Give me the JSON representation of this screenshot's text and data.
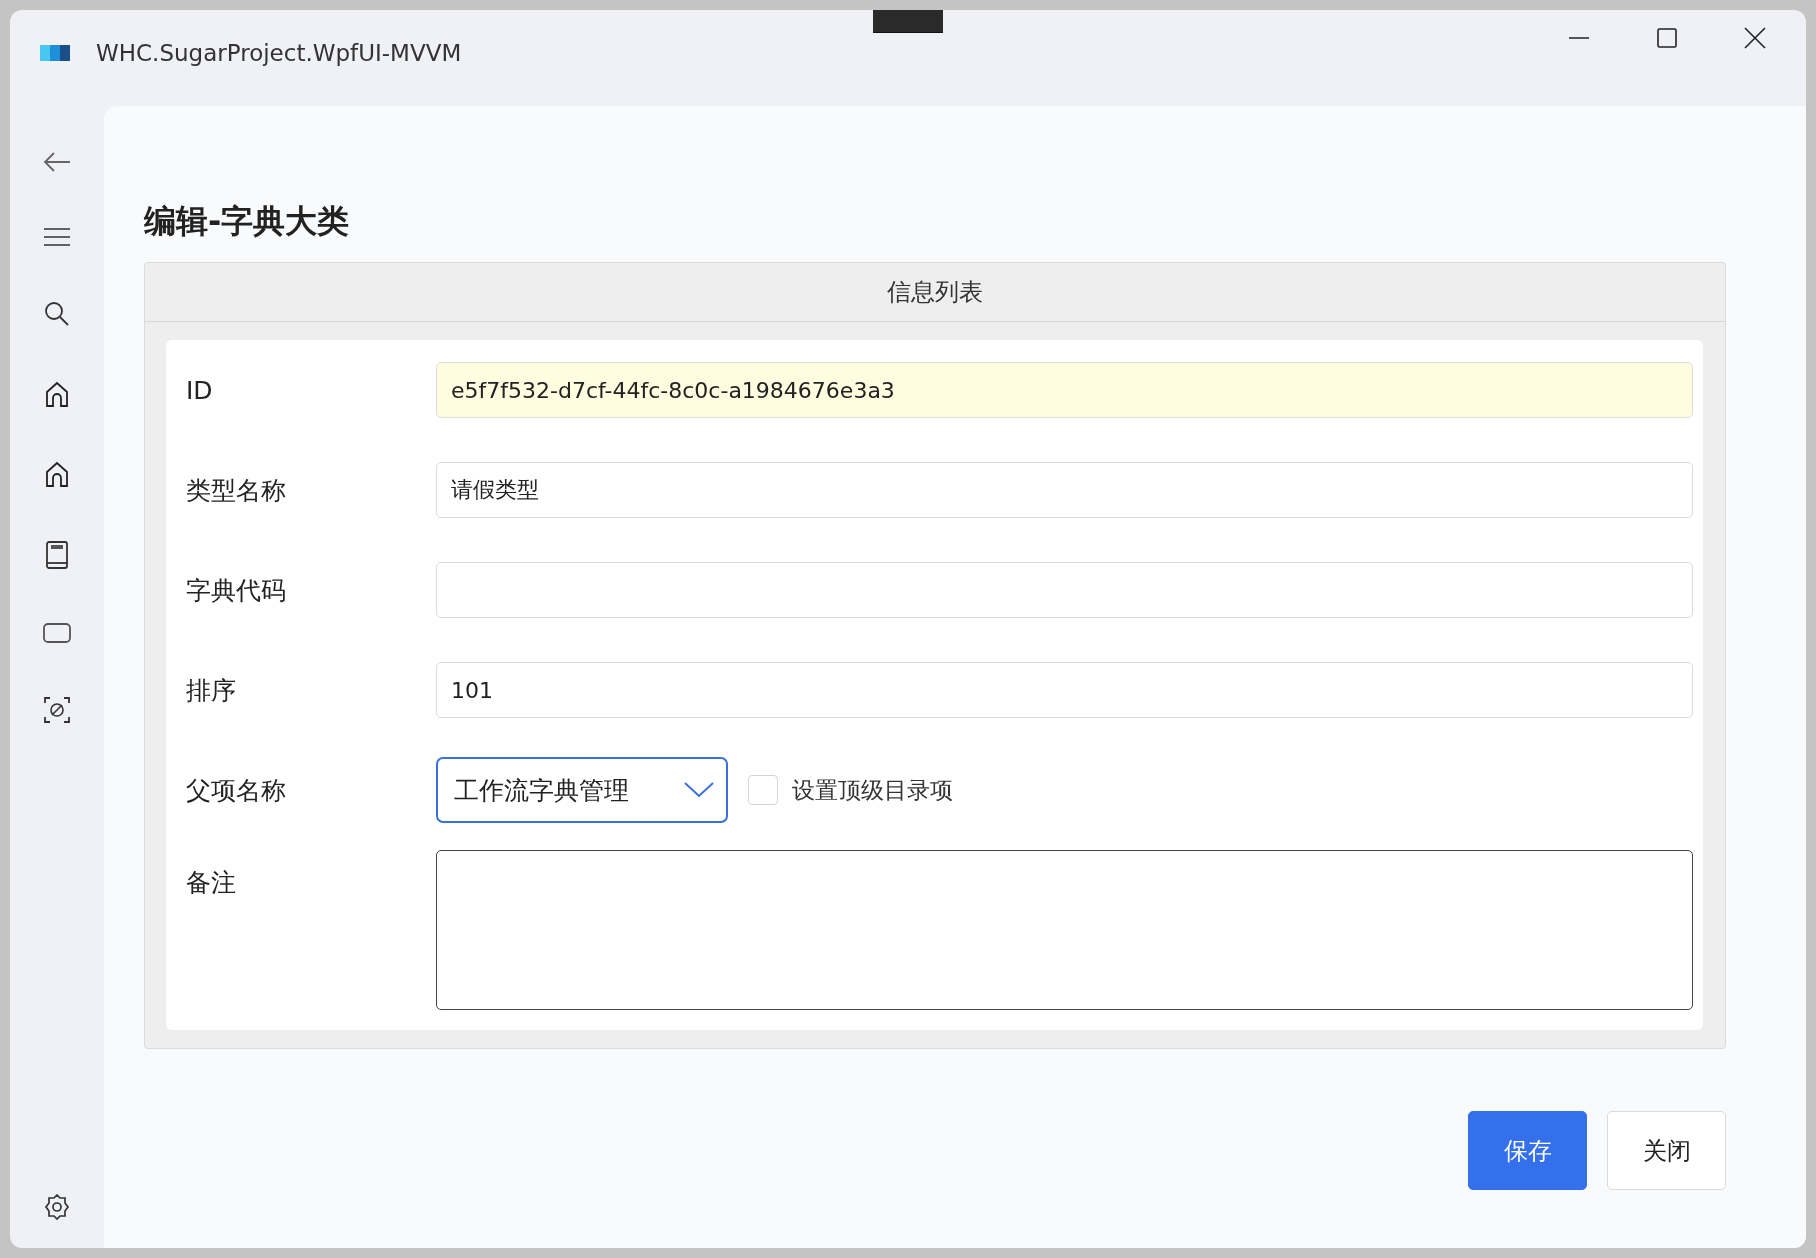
{
  "window": {
    "title": "WHC.SugarProject.WpfUI-MVVM"
  },
  "page": {
    "title": "编辑-字典大类"
  },
  "group": {
    "header": "信息列表"
  },
  "fields": [
    {
      "kind": "text",
      "label": "ID",
      "value": "e5f7f532-d7cf-44fc-8c0c-a1984676e3a3",
      "readonly": true
    },
    {
      "kind": "text",
      "label": "类型名称",
      "value": "请假类型",
      "readonly": false
    },
    {
      "kind": "text",
      "label": "字典代码",
      "readonly": false
    },
    {
      "kind": "text",
      "label": "排序",
      "value": "101",
      "readonly": false
    },
    {
      "kind": "dropdown",
      "label": "父项名称",
      "value": "工作流字典管理",
      "checkbox": {
        "label": "设置顶级目录项",
        "checked": false
      }
    },
    {
      "kind": "textarea",
      "label": "备注"
    }
  ],
  "buttons": [
    {
      "label": "保存",
      "primary": true
    },
    {
      "label": "关闭",
      "primary": false
    }
  ]
}
